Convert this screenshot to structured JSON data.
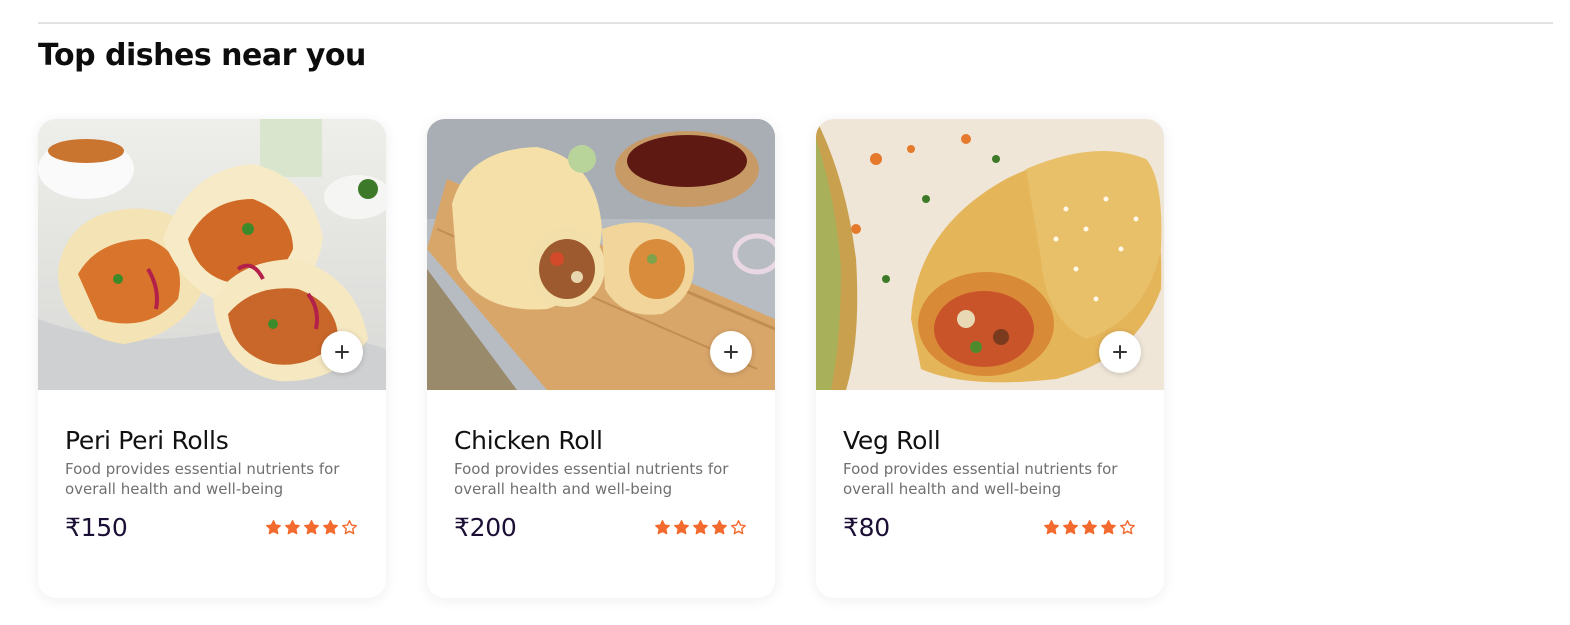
{
  "section": {
    "title": "Top dishes near you"
  },
  "colors": {
    "star": "#f26a2e",
    "price": "#1c0f35",
    "divider": "#e2e2e2",
    "description": "#707070"
  },
  "dishes": [
    {
      "name": "Peri Peri Rolls",
      "description": "Food provides essential nutrients for overall health and well-being",
      "price": "₹150",
      "rating": 4,
      "rating_max": 5,
      "image_icon": "peri-peri-rolls-photo",
      "add_icon": "plus-icon"
    },
    {
      "name": "Chicken Roll",
      "description": "Food provides essential nutrients for overall health and well-being",
      "price": "₹200",
      "rating": 4,
      "rating_max": 5,
      "image_icon": "chicken-roll-photo",
      "add_icon": "plus-icon"
    },
    {
      "name": "Veg Roll",
      "description": "Food provides essential nutrients for overall health and well-being",
      "price": "₹80",
      "rating": 4,
      "rating_max": 5,
      "image_icon": "veg-roll-photo",
      "add_icon": "plus-icon"
    }
  ]
}
